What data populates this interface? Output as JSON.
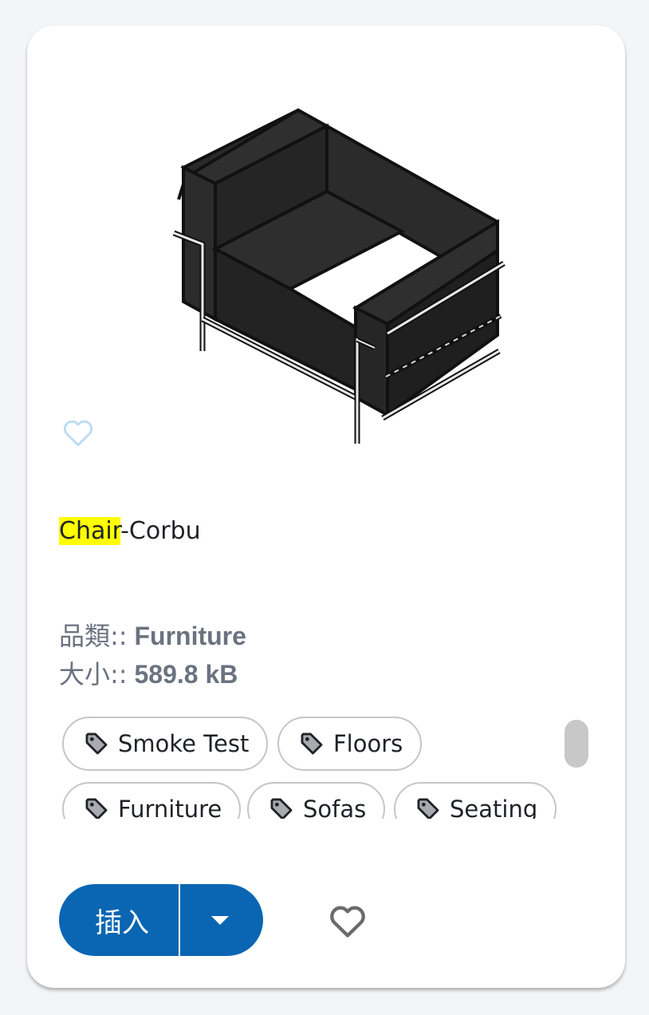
{
  "item": {
    "title_highlight": "Chair",
    "title_rest": "-Corbu",
    "category_label": "品類::",
    "category_value": "Furniture",
    "size_label": "大小::",
    "size_value": "589.8 kB"
  },
  "tags": [
    "Smoke Test",
    "Floors",
    "Furniture",
    "Sofas",
    "Seating"
  ],
  "actions": {
    "insert_label": "插入"
  },
  "colors": {
    "primary": "#0a66b2",
    "highlight": "#ffff00",
    "favorite_light": "#bcdcf4",
    "favorite_dark": "#6b6b6b"
  },
  "icons": {
    "thumbnail_favorite": "heart-outline-icon",
    "tag": "tag-icon",
    "dropdown": "caret-down-icon",
    "favorite": "heart-outline-icon"
  }
}
